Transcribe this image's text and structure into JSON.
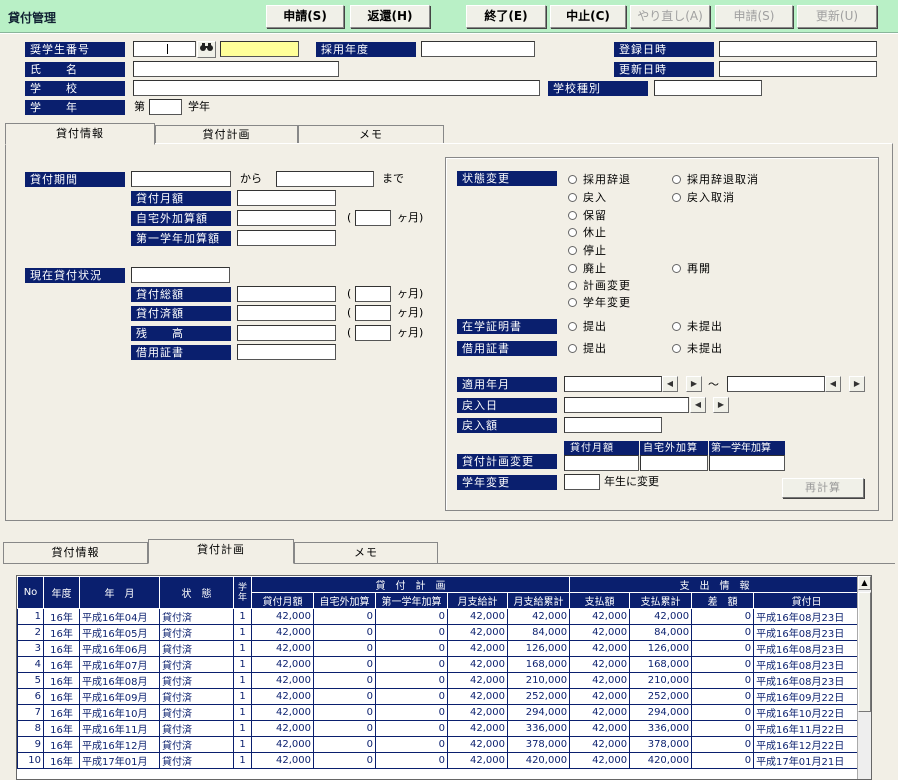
{
  "app_title": "貸付管理",
  "toolbar": {
    "apply": "申請(S)",
    "repay": "返還(H)",
    "end": "終了(E)",
    "cancel": "中止(C)",
    "redo": "やり直し(A)",
    "apply2": "申請(S)",
    "update": "更新(U)"
  },
  "header": {
    "scholar_no": "奨学生番号",
    "adopt_year": "採用年度",
    "reg_date": "登録日時",
    "name": "氏　　名",
    "upd_date": "更新日時",
    "school": "学　　校",
    "school_type": "学校種別",
    "grade": "学　　年",
    "grade_prefix": "第",
    "grade_suffix": "学年"
  },
  "tabs": [
    "貸付情報",
    "貸付計画",
    "メモ"
  ],
  "loan": {
    "period": "貸付期間",
    "from": "から",
    "to": "まで",
    "monthly": "貸付月額",
    "out_home": "自宅外加算額",
    "first_year": "第一学年加算額",
    "months_open": "(",
    "months_unit": "ヶ月)",
    "current": "現在貸付状況",
    "total": "貸付総額",
    "paid": "貸付済額",
    "balance": "残　　高",
    "certificate": "借用証書"
  },
  "status": {
    "change": "状態変更",
    "options": [
      "採用辞退",
      "採用辞退取消",
      "戻入",
      "戻入取消",
      "保留",
      "休止",
      "停止",
      "廃止",
      "再開",
      "計画変更",
      "学年変更"
    ],
    "enrollment": "在学証明書",
    "submitted": "提出",
    "not_submitted": "未提出",
    "loan_cert": "借用証書",
    "apply_month": "適用年月",
    "tilde": "～",
    "return_date": "戻入日",
    "return_amount": "戻入額",
    "plan_cols": [
      "貸付月額",
      "自宅外加算",
      "第一学年加算"
    ],
    "plan_change": "貸付計画変更",
    "grade_change": "学年変更",
    "grade_change_suffix": "年生に変更",
    "recalc": "再計算"
  },
  "grid": {
    "headers": {
      "no": "No",
      "fiscal": "年度",
      "yearmonth": "年　月",
      "state": "状　態",
      "grade": "学年",
      "plan": "貸　付　計　画",
      "monthly": "貸付月額",
      "out_home": "自宅外加算",
      "first_year": "第一学年加算",
      "month_total": "月支給計",
      "cumulative": "月支給累計",
      "payment": "支　出　情　報",
      "paid": "支払額",
      "paid_cum": "支払累計",
      "diff": "差　額",
      "loan_date": "貸付日"
    },
    "rows": [
      [
        "1",
        "16年",
        "平成16年04月",
        "貸付済",
        "1",
        "42,000",
        "0",
        "0",
        "42,000",
        "42,000",
        "42,000",
        "42,000",
        "0",
        "平成16年08月23日"
      ],
      [
        "2",
        "16年",
        "平成16年05月",
        "貸付済",
        "1",
        "42,000",
        "0",
        "0",
        "42,000",
        "84,000",
        "42,000",
        "84,000",
        "0",
        "平成16年08月23日"
      ],
      [
        "3",
        "16年",
        "平成16年06月",
        "貸付済",
        "1",
        "42,000",
        "0",
        "0",
        "42,000",
        "126,000",
        "42,000",
        "126,000",
        "0",
        "平成16年08月23日"
      ],
      [
        "4",
        "16年",
        "平成16年07月",
        "貸付済",
        "1",
        "42,000",
        "0",
        "0",
        "42,000",
        "168,000",
        "42,000",
        "168,000",
        "0",
        "平成16年08月23日"
      ],
      [
        "5",
        "16年",
        "平成16年08月",
        "貸付済",
        "1",
        "42,000",
        "0",
        "0",
        "42,000",
        "210,000",
        "42,000",
        "210,000",
        "0",
        "平成16年08月23日"
      ],
      [
        "6",
        "16年",
        "平成16年09月",
        "貸付済",
        "1",
        "42,000",
        "0",
        "0",
        "42,000",
        "252,000",
        "42,000",
        "252,000",
        "0",
        "平成16年09月22日"
      ],
      [
        "7",
        "16年",
        "平成16年10月",
        "貸付済",
        "1",
        "42,000",
        "0",
        "0",
        "42,000",
        "294,000",
        "42,000",
        "294,000",
        "0",
        "平成16年10月22日"
      ],
      [
        "8",
        "16年",
        "平成16年11月",
        "貸付済",
        "1",
        "42,000",
        "0",
        "0",
        "42,000",
        "336,000",
        "42,000",
        "336,000",
        "0",
        "平成16年11月22日"
      ],
      [
        "9",
        "16年",
        "平成16年12月",
        "貸付済",
        "1",
        "42,000",
        "0",
        "0",
        "42,000",
        "378,000",
        "42,000",
        "378,000",
        "0",
        "平成16年12月22日"
      ],
      [
        "10",
        "16年",
        "平成17年01月",
        "貸付済",
        "1",
        "42,000",
        "0",
        "0",
        "42,000",
        "420,000",
        "42,000",
        "420,000",
        "0",
        "平成17年01月21日"
      ]
    ]
  },
  "colors": {
    "label_bg": "#0a1f6e",
    "titlebar_bg": "#b9f0c6",
    "panel_bg": "#f2efe6",
    "highlight_input": "#ffff99"
  },
  "icons": {
    "search": "binoculars-icon"
  }
}
